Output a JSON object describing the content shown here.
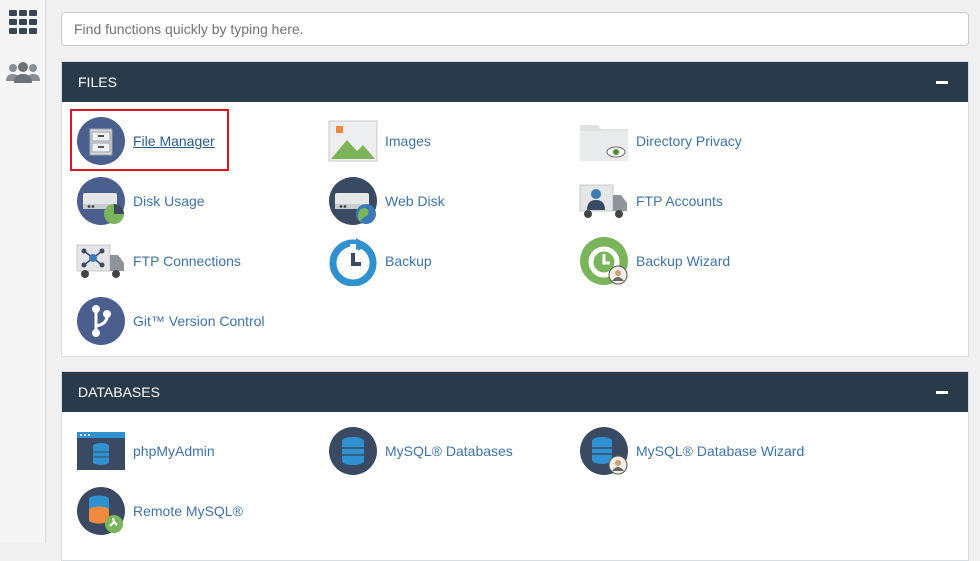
{
  "search": {
    "placeholder": "Find functions quickly by typing here."
  },
  "sidebar": {
    "items": [
      {
        "icon": "grid-icon",
        "tooltip": ""
      },
      {
        "icon": "users-icon",
        "tooltip": ""
      }
    ]
  },
  "files": {
    "title": "FILES",
    "items": [
      {
        "label": "File Manager",
        "icon": "file-cabinet-icon",
        "highlighted": true
      },
      {
        "label": "Images",
        "icon": "image-icon"
      },
      {
        "label": "Directory Privacy",
        "icon": "folder-eye-icon"
      },
      {
        "label": "Disk Usage",
        "icon": "disk-pie-icon"
      },
      {
        "label": "Web Disk",
        "icon": "web-disk-icon"
      },
      {
        "label": "FTP Accounts",
        "icon": "ftp-user-truck-icon"
      },
      {
        "label": "FTP Connections",
        "icon": "ftp-network-truck-icon"
      },
      {
        "label": "Backup",
        "icon": "backup-clock-icon"
      },
      {
        "label": "Backup Wizard",
        "icon": "backup-wizard-icon"
      },
      {
        "label": "Git™ Version Control",
        "icon": "git-branch-icon"
      }
    ]
  },
  "databases": {
    "title": "DATABASES",
    "items": [
      {
        "label": "phpMyAdmin",
        "icon": "phpmyadmin-icon"
      },
      {
        "label": "MySQL® Databases",
        "icon": "database-icon"
      },
      {
        "label": "MySQL® Database Wizard",
        "icon": "database-wizard-icon"
      },
      {
        "label": "Remote MySQL®",
        "icon": "remote-database-icon"
      }
    ]
  },
  "colors": {
    "header": "#293a4a",
    "link": "#3f73a6",
    "highlight_border": "#e0141e"
  }
}
